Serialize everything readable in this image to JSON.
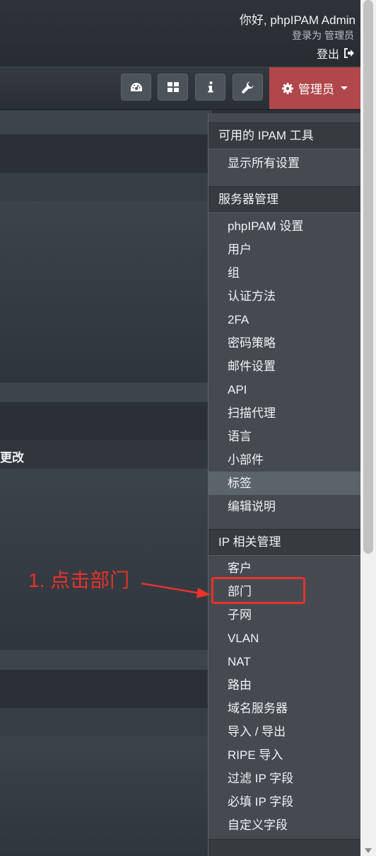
{
  "header": {
    "greeting": "你好, phpIPAM Admin",
    "logged_in_as": "登录为  管理员",
    "logout_label": "登出"
  },
  "toolbar": {
    "buttons": [
      {
        "icon": "dashboard-icon"
      },
      {
        "icon": "grid-icon"
      },
      {
        "icon": "info-icon"
      },
      {
        "icon": "wrench-icon"
      }
    ],
    "admin_label": "管理员",
    "admin_color": "#b0474a"
  },
  "background": {
    "partial_text": "更改"
  },
  "menu": {
    "sections": [
      {
        "title": "可用的 IPAM 工具",
        "items": [
          "显示所有设置"
        ]
      },
      {
        "title": "服务器管理",
        "items": [
          "phpIPAM 设置",
          "用户",
          "组",
          "认证方法",
          "2FA",
          "密码策略",
          "邮件设置",
          "API",
          "扫描代理",
          "语言",
          "小部件",
          "标签",
          "编辑说明"
        ]
      },
      {
        "title": "IP 相关管理",
        "items": [
          "客户",
          "部门",
          "子网",
          "VLAN",
          "NAT",
          "路由",
          "域名服务器",
          "导入 / 导出",
          "RIPE 导入",
          "过滤 IP 字段",
          "必填 IP 字段",
          "自定义字段"
        ]
      }
    ],
    "active_item": "标签"
  },
  "annotation": {
    "text": "1. 点击部门",
    "color": "#e8322b",
    "target": "部门"
  }
}
